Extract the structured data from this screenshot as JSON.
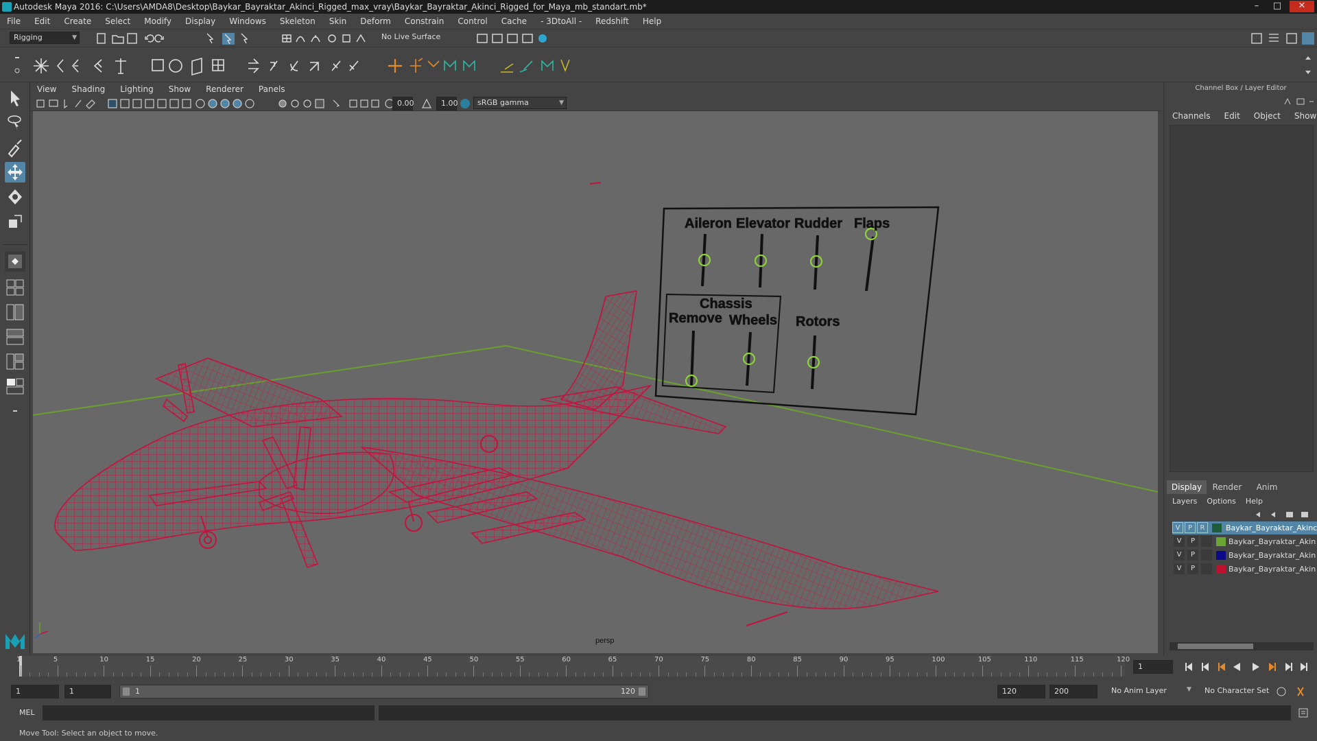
{
  "title_bar": {
    "text": "Autodesk Maya 2016: C:\\Users\\AMDA8\\Desktop\\Baykar_Bayraktar_Akinci_Rigged_max_vray\\Baykar_Bayraktar_Akinci_Rigged_for_Maya_mb_standart.mb*",
    "minimize": "–",
    "maximize": "□",
    "close": "✕"
  },
  "menu": [
    "File",
    "Edit",
    "Create",
    "Select",
    "Modify",
    "Display",
    "Windows",
    "Skeleton",
    "Skin",
    "Deform",
    "Constrain",
    "Control",
    "Cache",
    "- 3DtoAll -",
    "Redshift",
    "Help"
  ],
  "status_line": {
    "mode": "Rigging",
    "live_surface": "No Live Surface"
  },
  "viewport_menu": [
    "View",
    "Shading",
    "Lighting",
    "Show",
    "Renderer",
    "Panels"
  ],
  "viewport_toolbar": {
    "exposure": "0.00",
    "gamma": "1.00",
    "color_space": "sRGB gamma"
  },
  "viewport": {
    "camera_label": "persp",
    "rig_controls": {
      "aileron": "Aileron",
      "elevator": "Elevator",
      "rudder": "Rudder",
      "flaps": "Flaps",
      "chassis": "Chassis",
      "remove": "Remove",
      "wheels": "Wheels",
      "rotors": "Rotors"
    },
    "colors": {
      "wireframe": "#c2133f",
      "grid": "#6aa12e",
      "background": "#686868",
      "control": "#8fd13a"
    }
  },
  "channel_box": {
    "title": "Channel Box / Layer Editor",
    "menu": [
      "Channels",
      "Edit",
      "Object",
      "Show"
    ]
  },
  "layer_editor": {
    "tabs": [
      "Display",
      "Render",
      "Anim"
    ],
    "active_tab": "Display",
    "menu": [
      "Layers",
      "Options",
      "Help"
    ],
    "layers": [
      {
        "v": "V",
        "p": "P",
        "r": "R",
        "name": "Baykar_Bayraktar_Akinci_l",
        "color": "#1e5c3a",
        "selected": true
      },
      {
        "v": "V",
        "p": "P",
        "r": "",
        "name": "Baykar_Bayraktar_Akin",
        "color": "#6ba533",
        "selected": false
      },
      {
        "v": "V",
        "p": "P",
        "r": "",
        "name": "Baykar_Bayraktar_Akin",
        "color": "#0a0a8a",
        "selected": false
      },
      {
        "v": "V",
        "p": "P",
        "r": "",
        "name": "Baykar_Bayraktar_Akin",
        "color": "#c01030",
        "selected": false
      }
    ]
  },
  "timeline": {
    "ticks": [
      "1",
      "5",
      "10",
      "15",
      "20",
      "25",
      "30",
      "35",
      "40",
      "45",
      "50",
      "55",
      "60",
      "65",
      "70",
      "75",
      "80",
      "85",
      "90",
      "95",
      "100",
      "105",
      "110",
      "115",
      "120"
    ],
    "current_frame": "1"
  },
  "range": {
    "start": "1",
    "playback_start": "1",
    "range_start_label": "1",
    "range_end_label": "120",
    "playback_end": "120",
    "end": "200",
    "anim_layer": "No Anim Layer",
    "character_set": "No Character Set"
  },
  "command_line": {
    "language": "MEL"
  },
  "help_line": {
    "text": "Move Tool: Select an object to move."
  }
}
